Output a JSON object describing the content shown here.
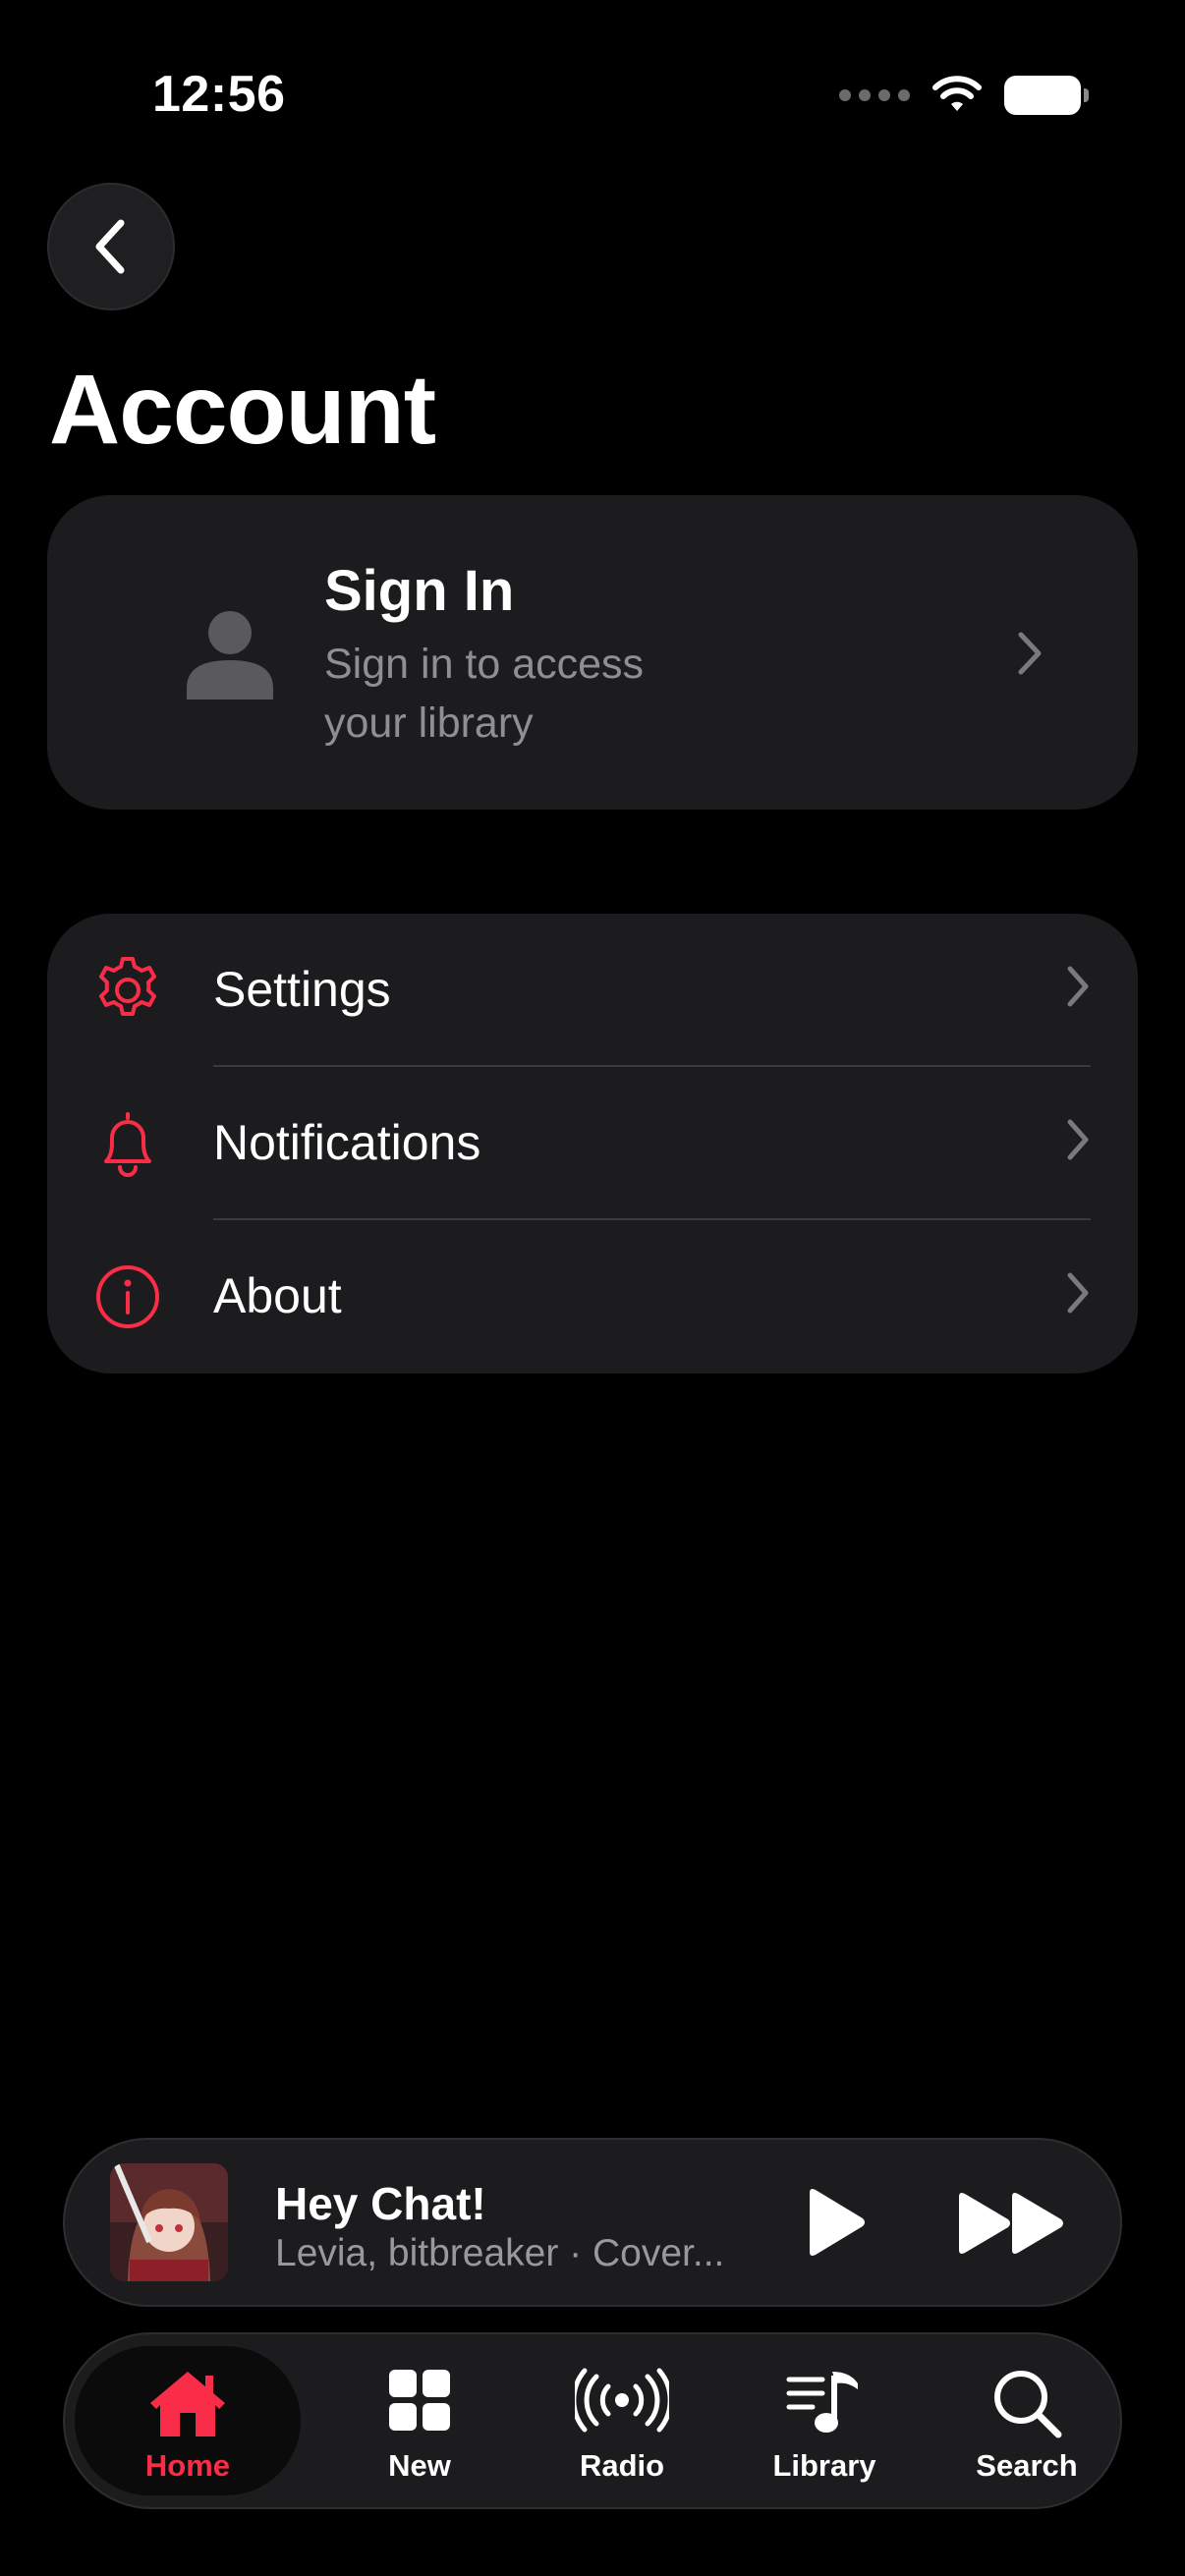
{
  "status_bar": {
    "time": "12:56"
  },
  "header": {
    "title": "Account"
  },
  "signin": {
    "title": "Sign In",
    "subtitle": "Sign in to access your library"
  },
  "menu": {
    "items": [
      {
        "label": "Settings",
        "icon": "gear-icon"
      },
      {
        "label": "Notifications",
        "icon": "bell-icon"
      },
      {
        "label": "About",
        "icon": "info-icon"
      }
    ]
  },
  "now_playing": {
    "title": "Hey Chat!",
    "subtitle": "Levia, bitbreaker · Cover..."
  },
  "tabs": [
    {
      "label": "Home",
      "icon": "house-icon",
      "active": true
    },
    {
      "label": "New",
      "icon": "grid-icon",
      "active": false
    },
    {
      "label": "Radio",
      "icon": "broadcast-icon",
      "active": false
    },
    {
      "label": "Library",
      "icon": "music-library-icon",
      "active": false
    },
    {
      "label": "Search",
      "icon": "search-icon",
      "active": false
    }
  ],
  "colors": {
    "accent": "#fa2d48",
    "background": "#000000",
    "card": "#1c1c1e"
  }
}
